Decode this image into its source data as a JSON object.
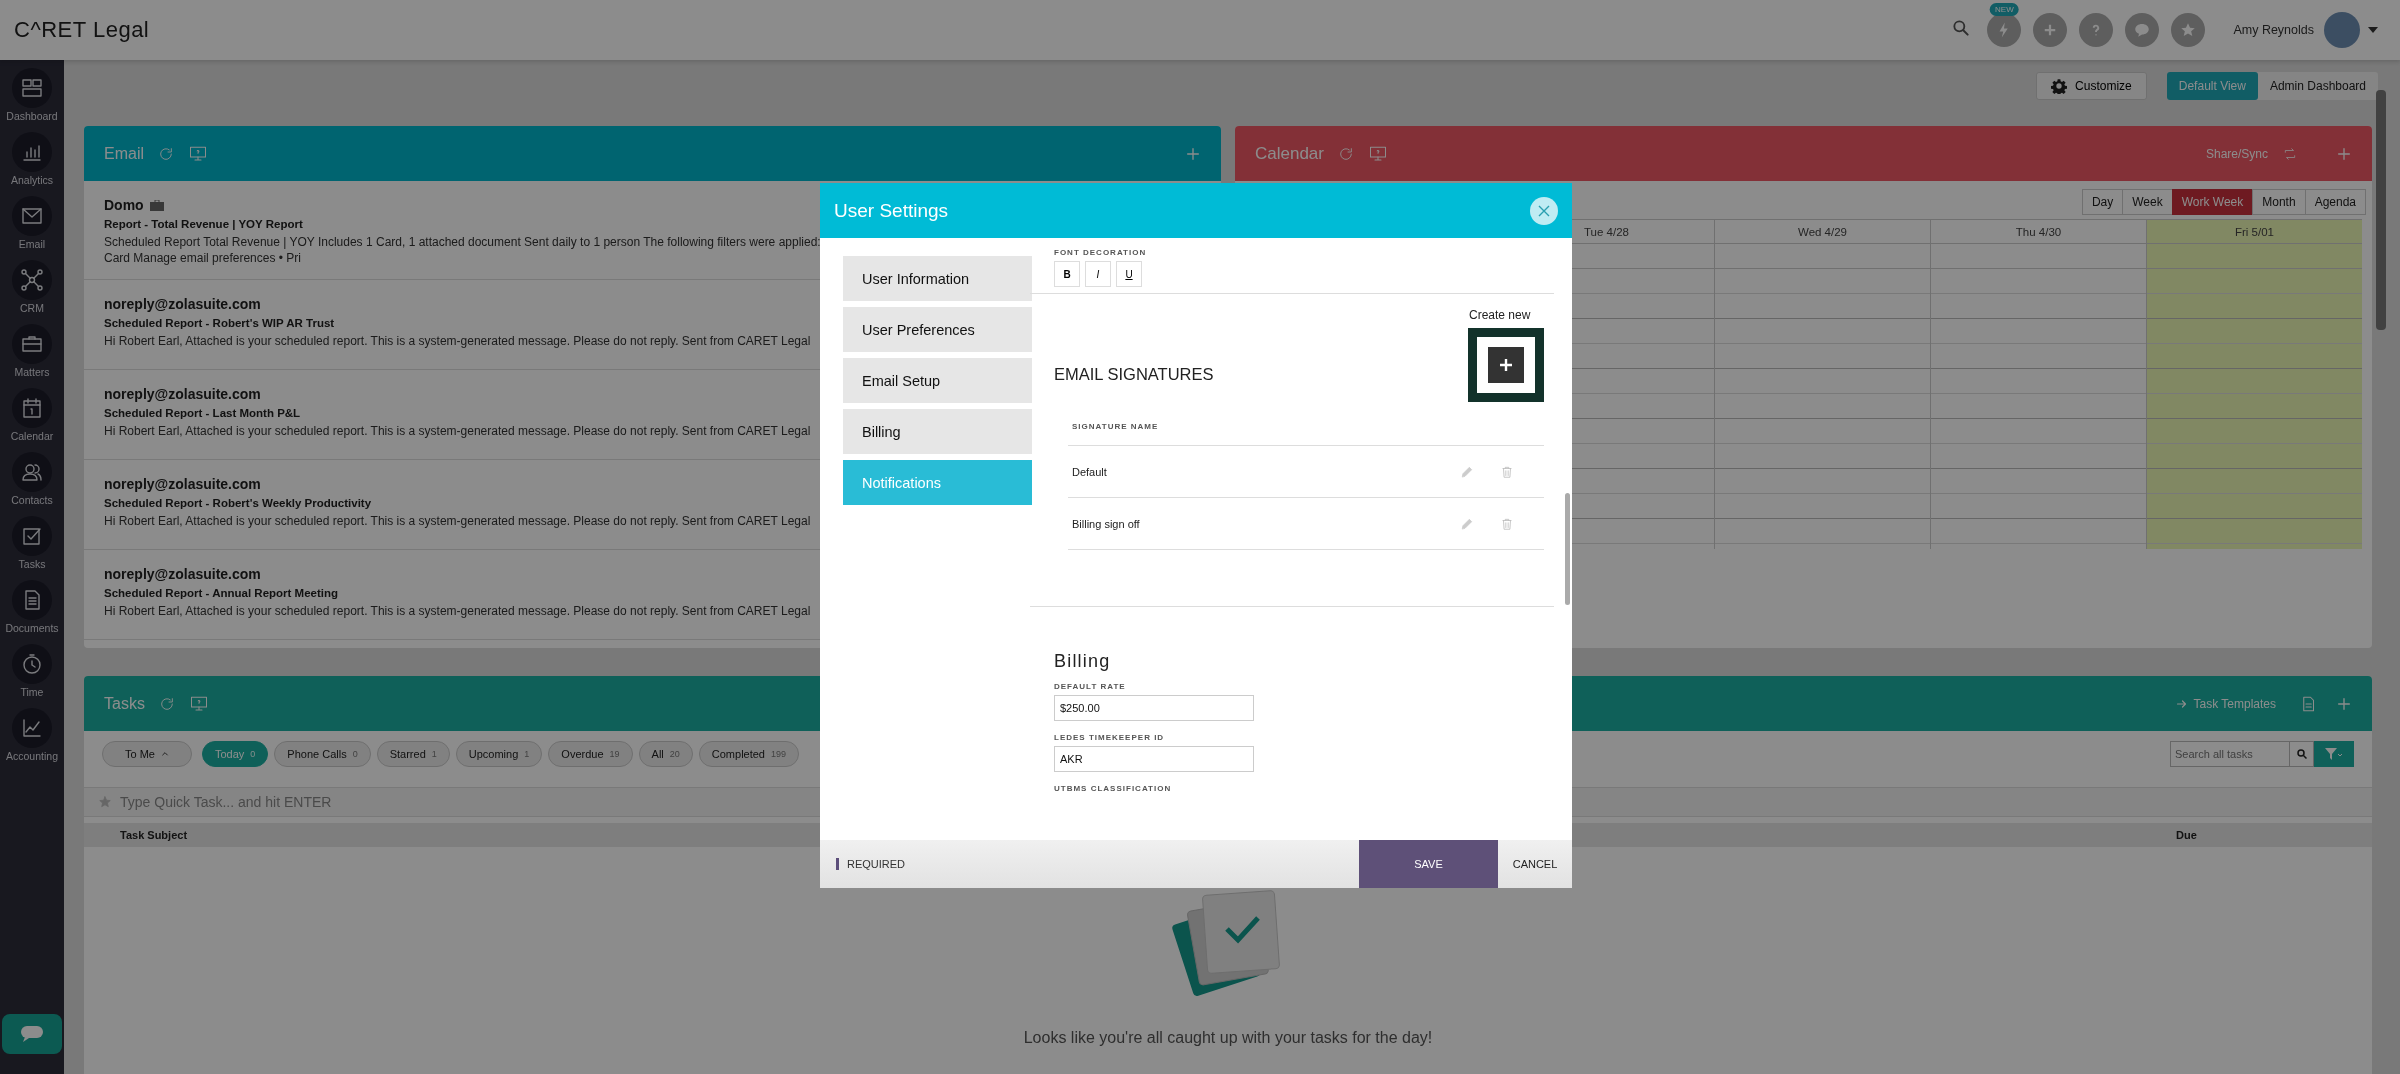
{
  "top_bar": {
    "logo": "C^RET Legal",
    "new_badge": "NEW",
    "user_name": "Amy Reynolds"
  },
  "sidebar": {
    "items": [
      {
        "label": "Dashboard",
        "kind": "dashboard"
      },
      {
        "label": "Analytics",
        "kind": "analytics"
      },
      {
        "label": "Email",
        "kind": "email"
      },
      {
        "label": "CRM",
        "kind": "crm"
      },
      {
        "label": "Matters",
        "kind": "matters"
      },
      {
        "label": "Calendar",
        "kind": "calendar"
      },
      {
        "label": "Contacts",
        "kind": "contacts"
      },
      {
        "label": "Tasks",
        "kind": "tasks"
      },
      {
        "label": "Documents",
        "kind": "documents"
      },
      {
        "label": "Time",
        "kind": "time"
      },
      {
        "label": "Accounting",
        "kind": "accounting"
      }
    ]
  },
  "dashboard_toolbar": {
    "customize": "Customize",
    "views": [
      {
        "label": "Default View",
        "selected": true
      },
      {
        "label": "Admin Dashboard",
        "selected": false
      }
    ]
  },
  "email_panel": {
    "title": "Email",
    "messages": [
      {
        "sender": "Domo",
        "briefcase": true,
        "subject": "Report - Total Revenue | YOY Report",
        "preview": [
          "Scheduled Report Total Revenue | YOY Includes 1 Card, 1 attached document Sent daily to 1 person The following filters were applied:",
          "Card Manage email preferences • Pri"
        ]
      },
      {
        "sender": "noreply@zolasuite.com",
        "briefcase": false,
        "subject": "Scheduled Report - Robert's WIP AR Trust",
        "preview": [
          "Hi Robert Earl, Attached is your scheduled report. This is a system-generated message. Please do not reply. Sent from CARET Legal"
        ]
      },
      {
        "sender": "noreply@zolasuite.com",
        "briefcase": false,
        "subject": "Scheduled Report - Last Month P&L",
        "preview": [
          "Hi Robert Earl, Attached is your scheduled report. This is a system-generated message. Please do not reply. Sent from CARET Legal"
        ]
      },
      {
        "sender": "noreply@zolasuite.com",
        "briefcase": false,
        "subject": "Scheduled Report - Robert's Weekly Productivity",
        "preview": [
          "Hi Robert Earl, Attached is your scheduled report. This is a system-generated message. Please do not reply. Sent from CARET Legal"
        ]
      },
      {
        "sender": "noreply@zolasuite.com",
        "briefcase": false,
        "subject": "Scheduled Report - Annual Report Meeting",
        "preview": [
          "Hi Robert Earl, Attached is your scheduled report. This is a system-generated message. Please do not reply. Sent from CARET Legal"
        ]
      }
    ]
  },
  "calendar_panel": {
    "title": "Calendar",
    "share": "Share/Sync",
    "views": [
      {
        "label": "Day",
        "selected": false
      },
      {
        "label": "Week",
        "selected": false
      },
      {
        "label": "Work Week",
        "selected": true
      },
      {
        "label": "Month",
        "selected": false
      },
      {
        "label": "Agenda",
        "selected": false
      }
    ],
    "days": [
      {
        "label": "Tue 4/28",
        "today": false
      },
      {
        "label": "Wed 4/29",
        "today": false
      },
      {
        "label": "Thu 4/30",
        "today": false
      },
      {
        "label": "Fri 5/01",
        "today": true
      }
    ]
  },
  "tasks_panel": {
    "title": "Tasks",
    "templates": "Task Templates",
    "owner_filter": "To Me",
    "filters": [
      {
        "label": "Today",
        "count": "0",
        "selected": true
      },
      {
        "label": "Phone Calls",
        "count": "0",
        "selected": false
      },
      {
        "label": "Starred",
        "count": "1",
        "selected": false
      },
      {
        "label": "Upcoming",
        "count": "1",
        "selected": false
      },
      {
        "label": "Overdue",
        "count": "19",
        "selected": false
      },
      {
        "label": "All",
        "count": "20",
        "selected": false
      },
      {
        "label": "Completed",
        "count": "199",
        "selected": false
      }
    ],
    "search": {
      "placeholder": "Search all tasks"
    },
    "quick_task": {
      "placeholder": "Type Quick Task... and hit ENTER"
    },
    "columns": [
      "Task Subject",
      "Due"
    ],
    "empty_message": "Looks like you're all caught up with your tasks for the day!"
  },
  "modal": {
    "title": "User Settings",
    "nav": [
      {
        "label": "User Information",
        "selected": false
      },
      {
        "label": "User Preferences",
        "selected": false
      },
      {
        "label": "Email Setup",
        "selected": false
      },
      {
        "label": "Billing",
        "selected": false
      },
      {
        "label": "Notifications",
        "selected": true
      }
    ],
    "font_decoration": {
      "label": "FONT DECORATION",
      "buttons": [
        {
          "label": "B",
          "kind": "bold"
        },
        {
          "label": "I",
          "kind": "italic"
        },
        {
          "label": "U",
          "kind": "underline"
        }
      ]
    },
    "tooltip": "Create new",
    "signatures": {
      "title": "EMAIL SIGNATURES",
      "column": "SIGNATURE NAME",
      "rows": [
        "Default",
        "Billing sign off"
      ]
    },
    "billing": {
      "title": "Billing",
      "fields": [
        {
          "label": "DEFAULT RATE",
          "value": "$250.00"
        },
        {
          "label": "LEDES TIMEKEEPER ID",
          "value": "AKR"
        }
      ],
      "next_label": "UTBMS CLASSIFICATION"
    },
    "footer": {
      "required": "REQUIRED",
      "save": "SAVE",
      "cancel": "CANCEL"
    }
  }
}
